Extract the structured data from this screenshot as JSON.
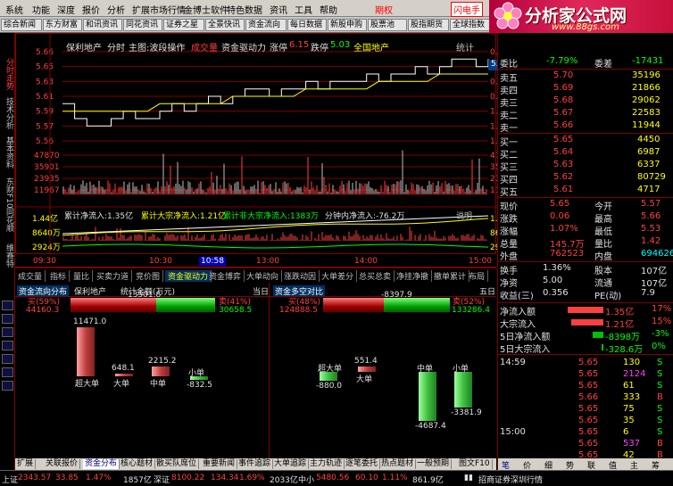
{
  "menu": [
    "系统",
    "功能",
    "深度",
    "报价",
    "分析",
    "扩展市场行情",
    "金博士软件",
    "特色数据",
    "资讯",
    "工具",
    "帮助",
    "期权",
    "闪电手"
  ],
  "tabs": [
    "综合新闻",
    "东方财富",
    "和讯资讯",
    "同花资讯",
    "证券之星",
    "全景快讯",
    "资金流向",
    "每日数据",
    "新股申购",
    "股票池",
    "股指期货",
    "全球指数"
  ],
  "logo": {
    "title": "分析家公式网",
    "url": "www.88gs.com"
  },
  "leftbar": [
    "分时走势",
    "技术分析",
    "基本资料",
    "东财F10",
    "同花顺",
    "维赛特"
  ],
  "chart": {
    "title_items": [
      {
        "t": "保利地产",
        "c": "wht"
      },
      {
        "t": "分时",
        "c": "wht"
      },
      {
        "t": "主图:波段操作",
        "c": "wht"
      },
      {
        "t": "成交量",
        "c": "red"
      },
      {
        "t": "资金驱动力",
        "c": "wht"
      },
      {
        "t": "涨停",
        "c": "wht"
      },
      {
        "t": "6.15",
        "c": "red"
      },
      {
        "t": "跌停",
        "c": "wht"
      },
      {
        "t": "5.03",
        "c": "grn"
      },
      {
        "t": "全国地产",
        "c": "yel"
      }
    ],
    "tool": "统计",
    "price_left": [
      "5.66",
      "5.65",
      "5.63",
      "5.61",
      "5.59",
      "5.57",
      "5.56"
    ],
    "price_right": [
      "0.18%",
      "0.00%",
      "0.35%",
      "0.71%",
      "1.06%",
      "1.42%",
      "1.59%"
    ],
    "cur_price": "5.63",
    "vol_left": [
      "47870",
      "35901",
      "23935",
      "11967"
    ],
    "vol_right": [
      "47870",
      "35901",
      "23935",
      "11967"
    ],
    "flow_title": [
      {
        "t": "累计净流入:1.35亿",
        "c": "wht"
      },
      {
        "t": "累计大宗净流入:1.21亿",
        "c": "yel"
      },
      {
        "t": "累计非大宗净流入:1383万",
        "c": "grn"
      },
      {
        "t": "分钟内净流入:-76.2万",
        "c": "wht"
      }
    ],
    "flow_btn": "说明",
    "flow_left": [
      "1.44亿",
      "8640万",
      "2924万"
    ],
    "flow_right": [
      "1.44亿",
      "8640万",
      "2924万"
    ],
    "times": [
      "09:30",
      "10:30",
      "10:58",
      "13:00",
      "14:00",
      "15:00"
    ],
    "price_series": [
      5.6,
      5.58,
      5.57,
      5.57,
      5.58,
      5.59,
      5.58,
      5.58,
      5.59,
      5.6,
      5.59,
      5.6,
      5.61,
      5.6,
      5.61,
      5.62,
      5.62,
      5.61,
      5.62,
      5.62,
      5.63,
      5.62,
      5.63,
      5.63,
      5.63,
      5.64,
      5.63,
      5.64,
      5.64,
      5.65,
      5.64,
      5.65,
      5.66,
      5.66,
      5.65,
      5.66
    ],
    "avg_series": [
      5.59,
      5.59,
      5.59,
      5.59,
      5.59,
      5.59,
      5.59,
      5.59,
      5.6,
      5.6,
      5.6,
      5.6,
      5.6,
      5.6,
      5.61,
      5.61,
      5.61,
      5.61,
      5.61,
      5.61,
      5.62,
      5.62,
      5.62,
      5.62,
      5.62,
      5.62,
      5.63,
      5.63,
      5.63,
      5.63,
      5.63,
      5.64,
      5.64,
      5.64,
      5.64,
      5.64
    ]
  },
  "tabs1": [
    "成交量",
    "指标",
    "量比",
    "买卖力道",
    "竞价图",
    "资金驱动力",
    "资金博弈",
    "大单动向",
    "涨跌动因",
    "大单差分",
    "总买总卖",
    "净挂净撤",
    "撤单累计",
    "布局"
  ],
  "lower": {
    "left_title": "资金流向分布",
    "left_sub1": "保利地产",
    "left_sub2": "统计金额(万元)",
    "left_right": "当日",
    "right_title": "资金多空对比",
    "right_right": "五日",
    "l_buy_pct": "买(59%)",
    "l_buy_val": "44160.3",
    "l_net": "13501.8",
    "l_sell_pct": "卖(41%)",
    "l_sell_val": "30658.5",
    "r_buy_pct": "买(48%)",
    "r_buy_val": "124888.5",
    "r_net": "-8397.9",
    "r_sell_pct": "卖(52%)",
    "r_sell_val": "133286.4",
    "l_bars": [
      {
        "name": "超大单",
        "v": 11471.0,
        "vs": "11471.0"
      },
      {
        "name": "大单",
        "v": 648.1,
        "vs": "648.1"
      },
      {
        "name": "中单",
        "v": 2215.2,
        "vs": "2215.2"
      },
      {
        "name": "小单",
        "v": -832.5,
        "vs": "-832.5"
      }
    ],
    "r_bars": [
      {
        "name": "超大单",
        "v": -880.0,
        "vs": "-880.0"
      },
      {
        "name": "大单",
        "v": 551.4,
        "vs": "551.4"
      },
      {
        "name": "中单",
        "v": -4687.4,
        "vs": "-4687.4"
      },
      {
        "name": "小单",
        "v": -3381.9,
        "vs": "-3381.9"
      }
    ]
  },
  "tabs2": [
    "扩展",
    "关联报价",
    "资金分布",
    "核心题材",
    "散买队席位",
    "重要新闻",
    "事件追踪",
    "大单追踪",
    "主力轨迹",
    "逐笔委托",
    "热点题材",
    "一般预期",
    "图文F10"
  ],
  "quote": {
    "weibi": {
      "l": "委比",
      "v": "-7.79%",
      "l2": "委差",
      "v2": "-17431"
    },
    "sells": [
      {
        "l": "卖五",
        "p": "5.70",
        "v": "35196"
      },
      {
        "l": "卖四",
        "p": "5.69",
        "v": "21866"
      },
      {
        "l": "卖三",
        "p": "5.68",
        "v": "29062"
      },
      {
        "l": "卖二",
        "p": "5.67",
        "v": "22583"
      },
      {
        "l": "卖一",
        "p": "5.66",
        "v": "11944"
      }
    ],
    "buys": [
      {
        "l": "买一",
        "p": "5.65",
        "v": "4450"
      },
      {
        "l": "买二",
        "p": "5.64",
        "v": "6987"
      },
      {
        "l": "买三",
        "p": "5.63",
        "v": "6337"
      },
      {
        "l": "买四",
        "p": "5.62",
        "v": "80729"
      },
      {
        "l": "买五",
        "p": "5.61",
        "v": "4717"
      }
    ],
    "info": [
      {
        "l": "现价",
        "v": "5.65",
        "l2": "今开",
        "v2": "5.57"
      },
      {
        "l": "涨跌",
        "v": "0.06",
        "l2": "最高",
        "v2": "5.66"
      },
      {
        "l": "涨幅",
        "v": "1.07%",
        "l2": "最低",
        "v2": "5.53"
      },
      {
        "l": "总量",
        "v": "145.7万",
        "l2": "量比",
        "v2": "1.42"
      },
      {
        "l": "外盘",
        "v": "762523",
        "l2": "内盘",
        "v2": "694626"
      }
    ],
    "info2": [
      {
        "l": "换手",
        "v": "1.36%",
        "l2": "股本",
        "v2": "107亿"
      },
      {
        "l": "净资",
        "v": "5.00",
        "l2": "流通",
        "v2": "107亿"
      },
      {
        "l": "收益(三)",
        "v": "0.356",
        "l2": "PE(动)",
        "v2": "7.9"
      }
    ],
    "flows": [
      {
        "l": "净流入额",
        "v": "1.35亿",
        "p": "17%",
        "c": "red",
        "w": 40
      },
      {
        "l": "大宗流入",
        "v": "1.21亿",
        "p": "15%",
        "c": "red",
        "w": 36
      },
      {
        "l": "5日净流入额",
        "v": "-8398万",
        "p": "-3%",
        "c": "grn",
        "w": 12
      },
      {
        "l": "5日大宗流入",
        "v": "-328.6万",
        "p": "0%",
        "c": "grn",
        "w": 2
      }
    ],
    "ticks": [
      {
        "t": "14:59",
        "p": "5.65",
        "v": "130",
        "f": "S"
      },
      {
        "t": "",
        "p": "5.65",
        "v": "2124",
        "f": "S"
      },
      {
        "t": "",
        "p": "5.65",
        "v": "61",
        "f": "S"
      },
      {
        "t": "",
        "p": "5.66",
        "v": "333",
        "f": "B"
      },
      {
        "t": "",
        "p": "5.65",
        "v": "75",
        "f": "S"
      },
      {
        "t": "",
        "p": "5.65",
        "v": "35",
        "f": "S"
      },
      {
        "t": "15:00",
        "p": "5.65",
        "v": "6",
        "f": "S"
      },
      {
        "t": "",
        "p": "5.65",
        "v": "537",
        "f": "B"
      },
      {
        "t": "",
        "p": "5.65",
        "v": "42",
        "f": "B"
      },
      {
        "t": "",
        "p": "5.65",
        "v": "1",
        "f": "B"
      }
    ],
    "bottom_tabs": [
      "笔",
      "价",
      "细",
      "势",
      "联",
      "值",
      "主",
      "筹"
    ]
  },
  "status": {
    "sh_label": "上证",
    "sh": "2343.57",
    "sh_chg": "33.85",
    "sh_pct": "1.47%",
    "sh_vol": "1857亿",
    "sz_label": "深证",
    "sz": "8100.22",
    "sz_chg": "134.34",
    "sz_pct": "1.69%",
    "sz_vol": "2033亿",
    "zx_label": "中小",
    "zx": "5480.56",
    "zx_chg": "60.10",
    "zx_pct": "1.11%",
    "zx_vol": "861.9亿",
    "broker": "招商证券深圳行情"
  }
}
